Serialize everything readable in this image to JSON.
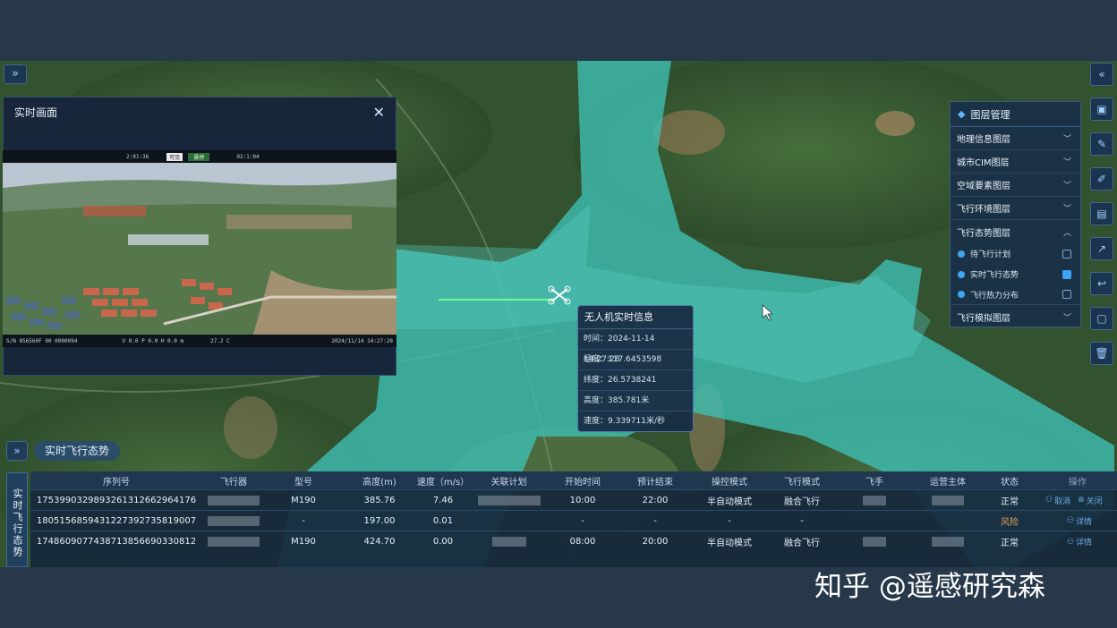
{
  "map": {
    "colors": {
      "corridor": "#3fc0b5",
      "terrain": "#2f4f2d"
    }
  },
  "video_panel": {
    "title": "实时画面",
    "close_icon": "close-icon",
    "osd_top": [
      "2:01:36",
      "可见",
      "悬停",
      "02:1:04"
    ],
    "osd_bottom_left": "S/N 856560F 00 0000094",
    "osd_bottom_mid": "V 0.0  P 0.0  H 0.0 m",
    "osd_bottom_temp": "27.2 C",
    "osd_bottom_time": "2024/11/14  14:27:28"
  },
  "layer_panel": {
    "title": "图层管理",
    "groups": [
      {
        "label": "地理信息图层",
        "state": "collapsed"
      },
      {
        "label": "城市CIM图层",
        "state": "collapsed"
      },
      {
        "label": "空域要素图层",
        "state": "collapsed"
      },
      {
        "label": "飞行环境图层",
        "state": "collapsed"
      },
      {
        "label": "飞行态势图层",
        "state": "expanded"
      }
    ],
    "sub_items": [
      {
        "label": "待飞行计划",
        "checked": false
      },
      {
        "label": "实时飞行态势",
        "checked": true
      },
      {
        "label": "飞行热力分布",
        "checked": false
      }
    ],
    "last_group": {
      "label": "飞行模拟图层",
      "state": "collapsed"
    }
  },
  "toolbar": {
    "collapse_icon": "double-chevron-left-icon",
    "tools": [
      "cube-icon",
      "edit-icon",
      "pencil-icon",
      "save-icon",
      "chart-icon",
      "undo-icon",
      "frame-icon",
      "trash-icon"
    ]
  },
  "info_popup": {
    "title": "无人机实时信息",
    "time": "时间：2024-11-14 14:27:28",
    "lng": "经度：117.6453598",
    "lat": "纬度：26.5738241",
    "alt": "高度：385.781米",
    "speed": "速度：9.339711米/秒"
  },
  "flight_status": {
    "title": "实时飞行态势",
    "side_label": "实时飞行态势",
    "columns": [
      "序列号",
      "飞行器",
      "型号",
      "高度(m)",
      "速度（m/s）",
      "关联计划",
      "开始时间",
      "预计结束",
      "操控模式",
      "飞行模式",
      "飞手",
      "运营主体",
      "状态",
      "操作"
    ],
    "rows": [
      {
        "serial": "1753990329893261312662964176",
        "model": "M190",
        "alt": "385.76",
        "speed": "7.46",
        "start": "10:00",
        "end": "22:00",
        "ctrl": "半自动模式",
        "mode": "融合飞行",
        "status": "正常",
        "actions": [
          "取消",
          "关闭"
        ]
      },
      {
        "serial": "1805156859431227392735819007",
        "model": "-",
        "alt": "197.00",
        "speed": "0.01",
        "start": "-",
        "end": "-",
        "ctrl": "-",
        "mode": "-",
        "status": "风险",
        "actions": [
          "详情"
        ]
      },
      {
        "serial": "1748609077438713856690330812",
        "model": "M190",
        "alt": "424.70",
        "speed": "0.00",
        "start": "08:00",
        "end": "20:00",
        "ctrl": "半自动模式",
        "mode": "融合飞行",
        "status": "正常",
        "actions": [
          "详情"
        ]
      }
    ]
  },
  "watermark": "知乎 @遥感研究森"
}
